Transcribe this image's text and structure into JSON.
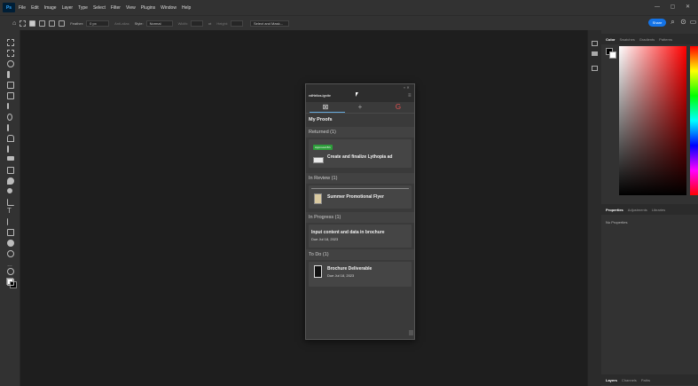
{
  "app": {
    "logo": "Ps"
  },
  "menu": [
    "File",
    "Edit",
    "Image",
    "Layer",
    "Type",
    "Select",
    "Filter",
    "View",
    "Plugins",
    "Window",
    "Help"
  ],
  "window_controls": "— ▢ ✕",
  "options_bar": {
    "feather_label": "Feather:",
    "feather_value": "0 px",
    "antialias_label": "Anti-alias",
    "style_label": "Style:",
    "style_value": "Normal",
    "width_label": "Width:",
    "height_label": "Height:",
    "select_mask": "Select and Mask...",
    "share": "Share"
  },
  "right_panel": {
    "top_tabs": [
      "Color",
      "Swatches",
      "Gradients",
      "Patterns"
    ],
    "mid_tabs": [
      "Properties",
      "Adjustments",
      "Libraries"
    ],
    "no_properties": "No Properties",
    "bottom_tabs": [
      "Layers",
      "Channels",
      "Paths"
    ]
  },
  "plugin": {
    "title": "edHelios.ignite",
    "collapse": "«  ✕",
    "menu_icon": "≡",
    "tabs": [
      {
        "icon": "proofs-icon",
        "glyph": "⊠",
        "color": "#dddddd"
      },
      {
        "icon": "plus-icon",
        "glyph": "+",
        "color": "#aaaaaa"
      },
      {
        "icon": "refresh-icon",
        "glyph": "G",
        "color": "#e05050"
      }
    ],
    "heading": "My Proofs",
    "sections": [
      {
        "title": "Returned (1)",
        "items": [
          {
            "badge": "Approved 8/1",
            "title": "Create and finalize Lythopia ad",
            "date": ""
          }
        ]
      },
      {
        "title": "In Review (1)",
        "items": [
          {
            "badge": "",
            "title": "Summer Promotional Flyer",
            "date": ""
          }
        ]
      },
      {
        "title": "In Progress (1)",
        "items": [
          {
            "badge": "",
            "title": "Input content and data in brochure",
            "date": "Due Jul 18, 2023"
          }
        ]
      },
      {
        "title": "To Do (1)",
        "items": [
          {
            "badge": "",
            "title": "Brochure Deliverable",
            "date": "Due Jul 18, 2023"
          }
        ]
      }
    ]
  }
}
